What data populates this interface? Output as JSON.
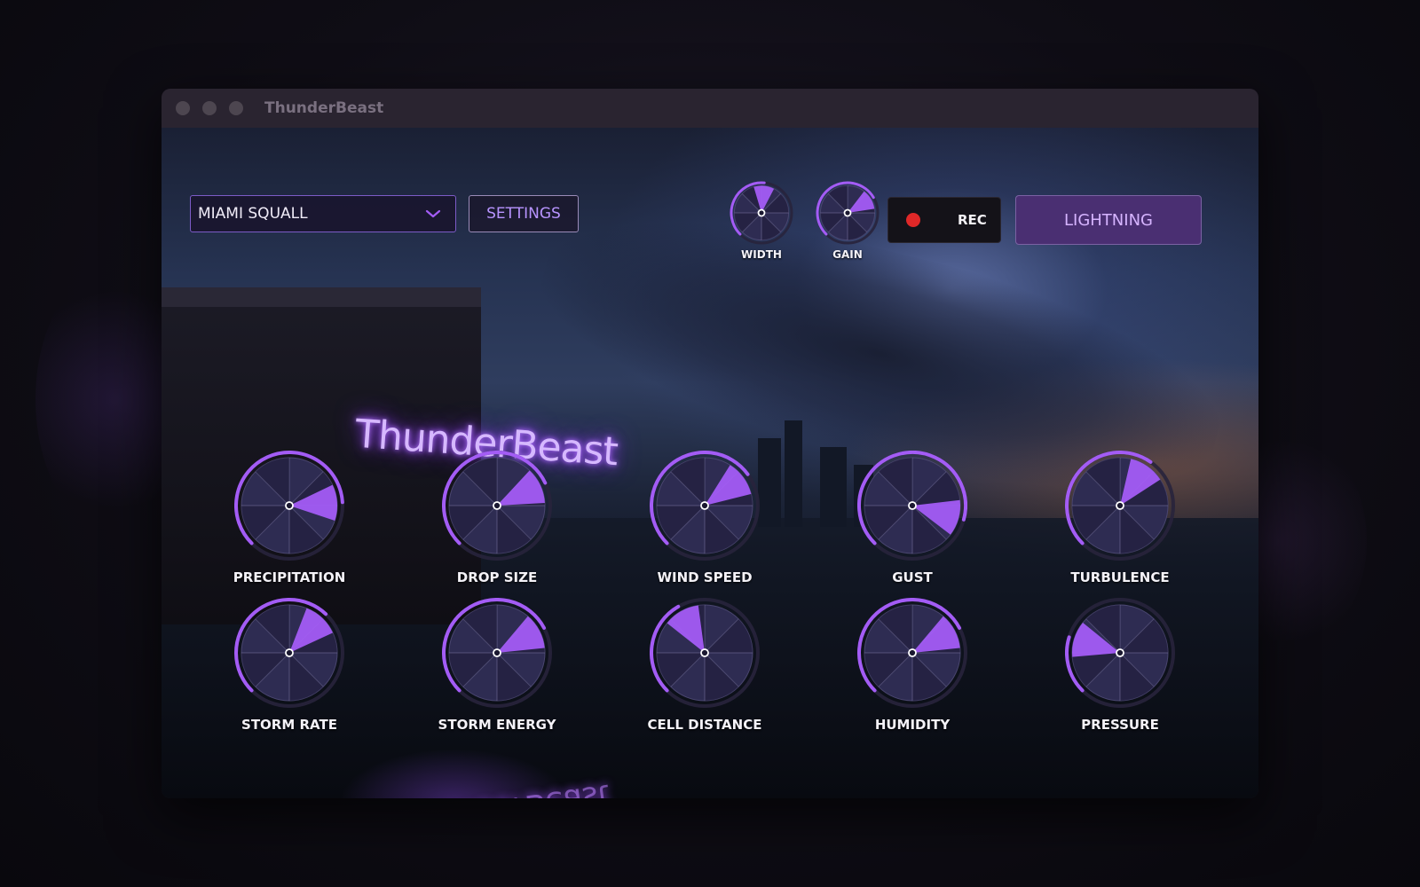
{
  "window": {
    "title": "ThunderBeast"
  },
  "scene": {
    "neon_sign": "ThunderBeast",
    "neon_reflection": "ThunderBeast"
  },
  "colors": {
    "accent": "#a35cf5",
    "knob_face": "#2e2c52",
    "rec_dot": "#e02828",
    "lightning_bg": "#4a2f72"
  },
  "toolbar": {
    "preset": {
      "value": "MIAMI SQUALL",
      "icon": "chevron-down-icon"
    },
    "settings_label": "SETTINGS",
    "rec_label": "REC",
    "lightning_label": "LIGHTNING"
  },
  "small_knobs": [
    {
      "id": "width",
      "label": "WIDTH",
      "value": 0.52
    },
    {
      "id": "gain",
      "label": "GAIN",
      "value": 0.72
    }
  ],
  "knobs": [
    {
      "id": "precipitation",
      "label": "PRECIPITATION",
      "value": 0.82
    },
    {
      "id": "drop-size",
      "label": "DROP SIZE",
      "value": 0.74
    },
    {
      "id": "wind-speed",
      "label": "WIND SPEED",
      "value": 0.7
    },
    {
      "id": "gust",
      "label": "GUST",
      "value": 0.89
    },
    {
      "id": "turbulence",
      "label": "TURBULENCE",
      "value": 0.63
    },
    {
      "id": "storm-rate",
      "label": "STORM RATE",
      "value": 0.66
    },
    {
      "id": "storm-energy",
      "label": "STORM ENERGY",
      "value": 0.73
    },
    {
      "id": "cell-distance",
      "label": "CELL DISTANCE",
      "value": 0.39
    },
    {
      "id": "humidity",
      "label": "HUMIDITY",
      "value": 0.73
    },
    {
      "id": "pressure",
      "label": "PRESSURE",
      "value": 0.23
    }
  ]
}
